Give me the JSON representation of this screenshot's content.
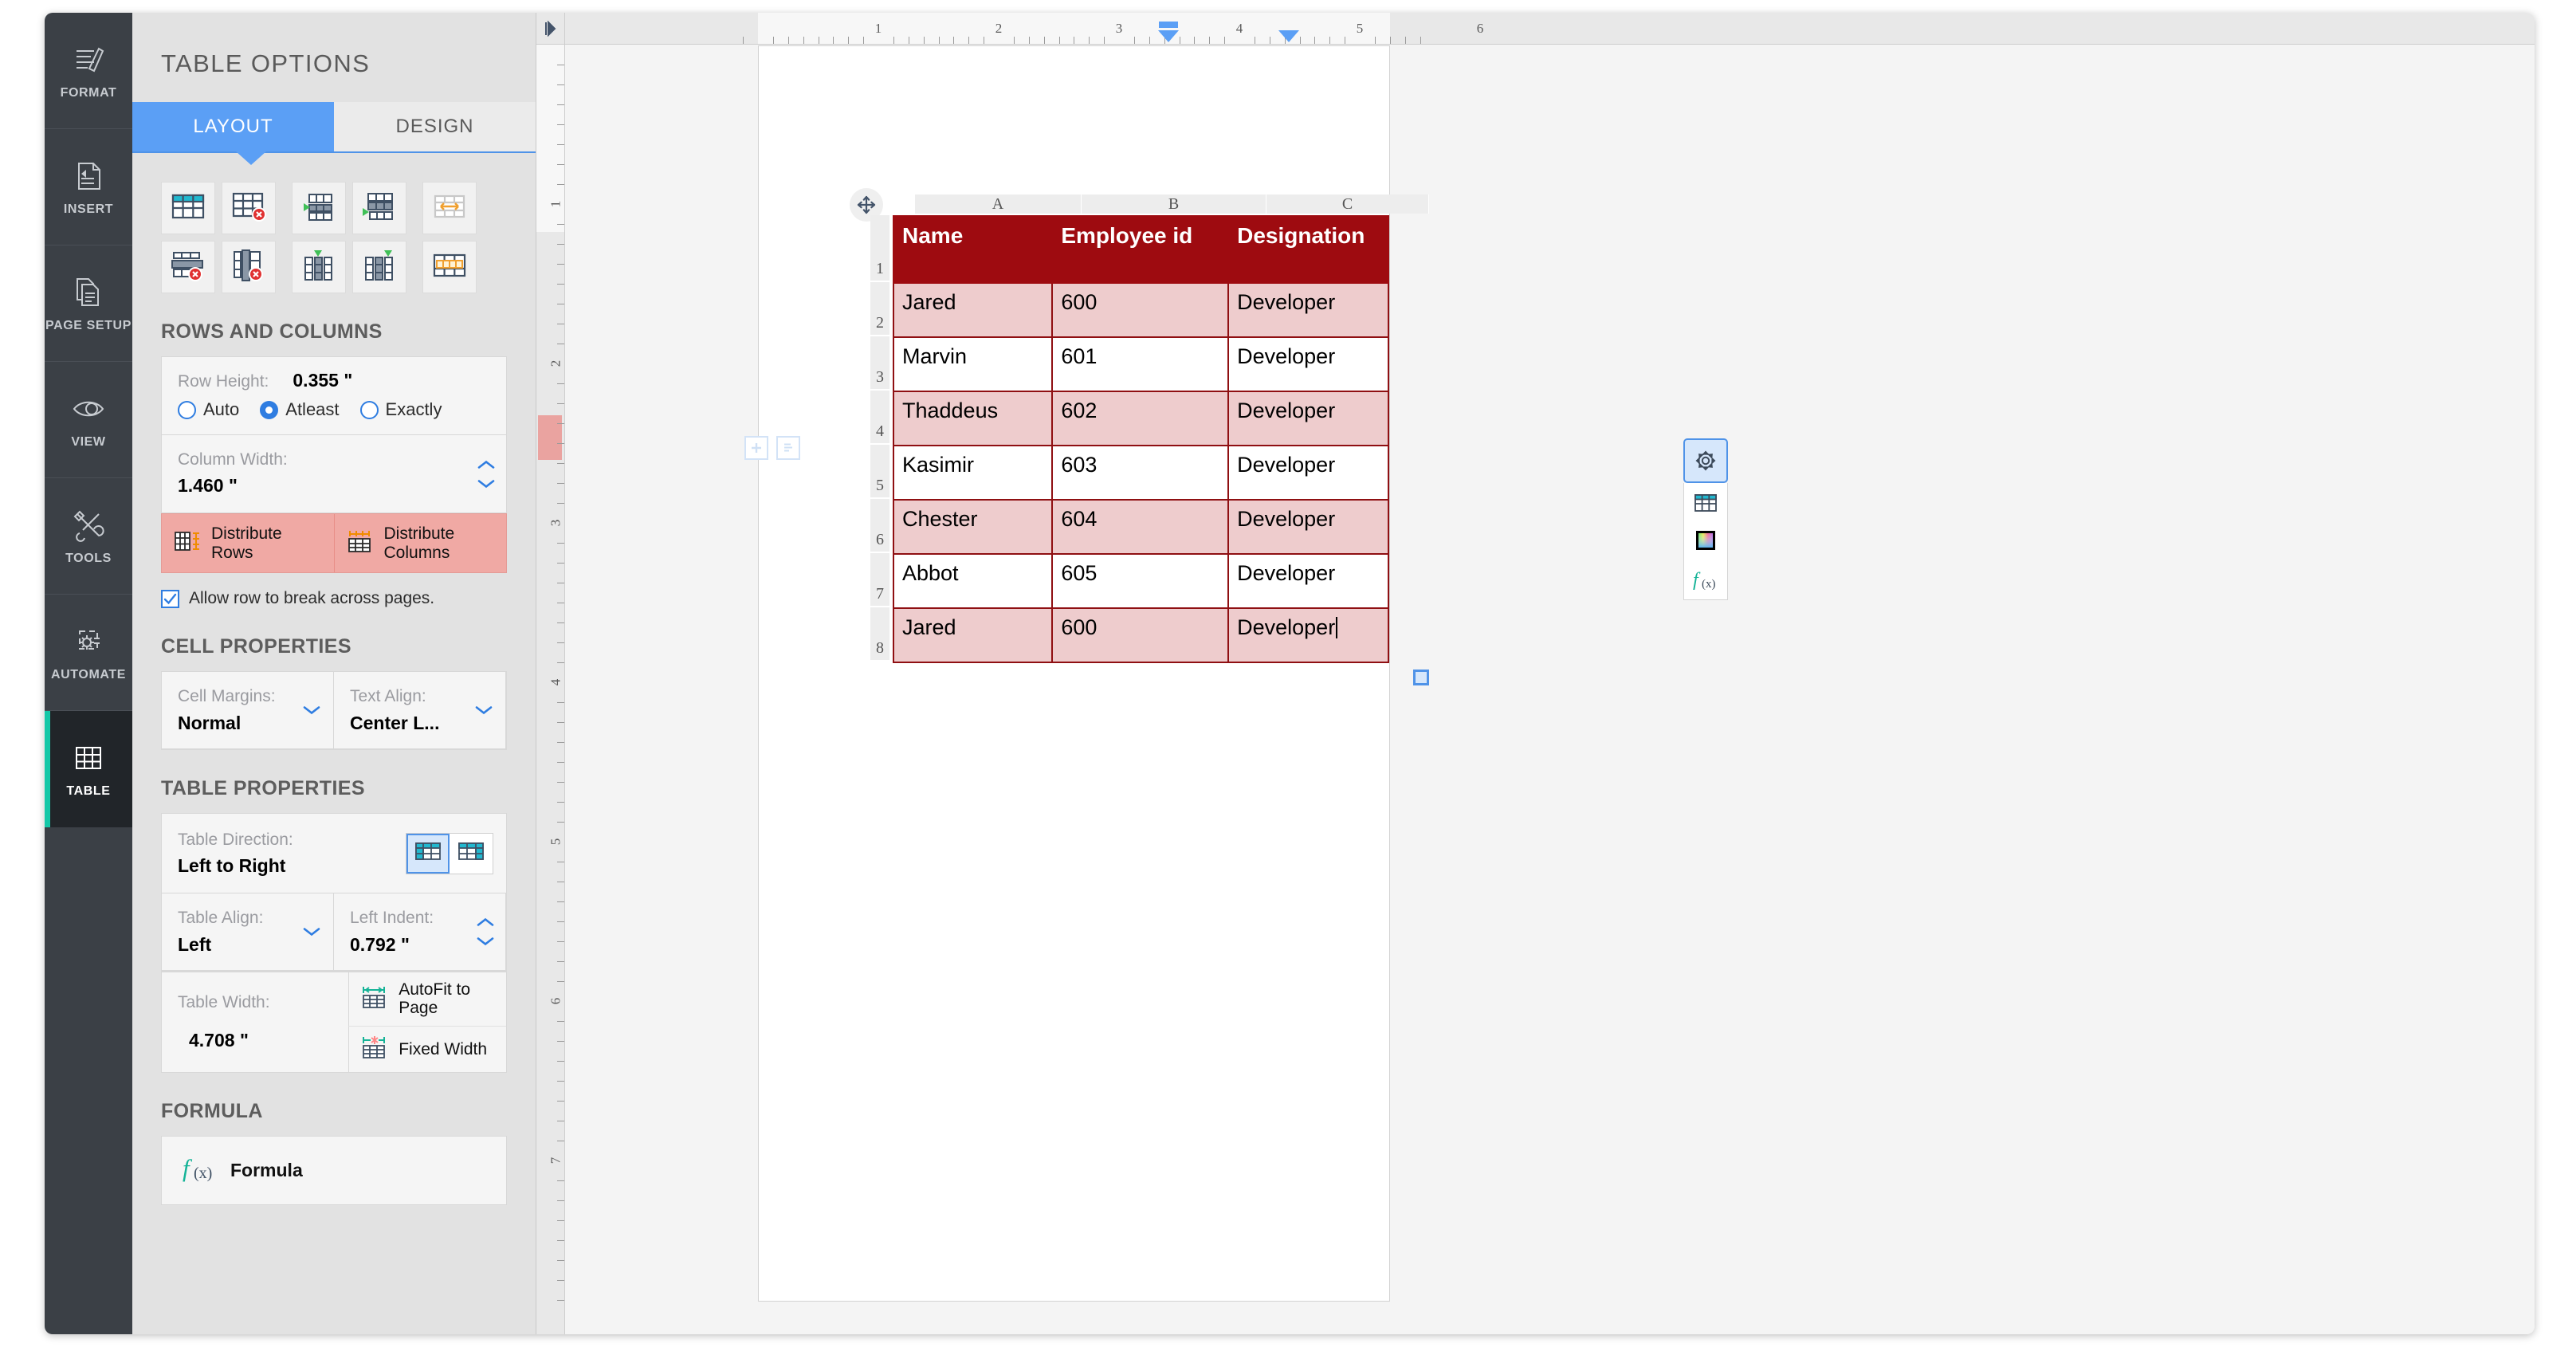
{
  "rail": {
    "items": [
      {
        "label": "FORMAT",
        "icon": "format-brush-icon",
        "active": false
      },
      {
        "label": "INSERT",
        "icon": "insert-document-icon",
        "active": false
      },
      {
        "label": "PAGE SETUP",
        "icon": "page-setup-icon",
        "active": false
      },
      {
        "label": "VIEW",
        "icon": "eye-icon",
        "active": false
      },
      {
        "label": "TOOLS",
        "icon": "tools-icon",
        "active": false
      },
      {
        "label": "AUTOMATE",
        "icon": "automate-gear-icon",
        "active": false
      },
      {
        "label": "TABLE",
        "icon": "table-grid-icon",
        "active": true
      }
    ]
  },
  "panel": {
    "title": "TABLE OPTIONS",
    "tabs": [
      {
        "label": "LAYOUT",
        "active": true
      },
      {
        "label": "DESIGN",
        "active": false
      }
    ],
    "layout_buttons": [
      {
        "name": "insert-table-button",
        "icon": "insert-table-icon"
      },
      {
        "name": "delete-table-button",
        "icon": "delete-table-icon"
      },
      {
        "name": "insert-row-above-button",
        "icon": "insert-row-above-icon"
      },
      {
        "name": "insert-row-below-button",
        "icon": "insert-row-below-icon"
      },
      {
        "name": "merge-cells-button",
        "icon": "merge-cells-icon"
      },
      {
        "name": "delete-row-button",
        "icon": "delete-row-icon"
      },
      {
        "name": "delete-column-button",
        "icon": "delete-column-icon"
      },
      {
        "name": "insert-column-left-button",
        "icon": "insert-column-left-icon"
      },
      {
        "name": "insert-column-right-button",
        "icon": "insert-column-right-icon"
      },
      {
        "name": "split-cells-button",
        "icon": "split-cells-icon"
      }
    ],
    "rows_and_columns": {
      "heading": "ROWS AND COLUMNS",
      "row_height_label": "Row Height:",
      "row_height_value": "0.355 \"",
      "row_height_modes": [
        {
          "label": "Auto",
          "selected": false
        },
        {
          "label": "Atleast",
          "selected": true
        },
        {
          "label": "Exactly",
          "selected": false
        }
      ],
      "column_width_label": "Column Width:",
      "column_width_value": "1.460 \"",
      "distribute_rows_label": "Distribute Rows",
      "distribute_columns_label": "Distribute Columns",
      "allow_break_label": "Allow row to break across pages.",
      "allow_break_checked": true
    },
    "cell_properties": {
      "heading": "CELL PROPERTIES",
      "cell_margins_label": "Cell Margins:",
      "cell_margins_value": "Normal",
      "text_align_label": "Text Align:",
      "text_align_value": "Center L..."
    },
    "table_properties": {
      "heading": "TABLE PROPERTIES",
      "table_direction_label": "Table Direction:",
      "table_direction_value": "Left to Right",
      "direction_ltr_selected": true,
      "table_align_label": "Table Align:",
      "table_align_value": "Left",
      "left_indent_label": "Left Indent:",
      "left_indent_value": "0.792 \"",
      "table_width_label": "Table Width:",
      "table_width_value": "4.708 \"",
      "autofit_label": "AutoFit to Page",
      "fixed_width_label": "Fixed Width"
    },
    "formula": {
      "heading": "FORMULA",
      "button_label": "Formula"
    }
  },
  "document": {
    "h_ruler_numbers": [
      "1",
      "2",
      "3",
      "4",
      "5",
      "6"
    ],
    "v_ruler_numbers": [
      "1",
      "2",
      "3",
      "4",
      "5",
      "6",
      "7"
    ],
    "indent_markers": {
      "first_line": "3.1",
      "right": "4.7"
    },
    "table": {
      "column_headers": [
        "A",
        "B",
        "C"
      ],
      "row_numbers": [
        "1",
        "2",
        "3",
        "4",
        "5",
        "6",
        "7",
        "8"
      ],
      "header_row": [
        "Name",
        "Employee id",
        "Designation"
      ],
      "rows": [
        {
          "cells": [
            "Jared",
            "600",
            "Developer"
          ],
          "shaded": true
        },
        {
          "cells": [
            "Marvin",
            "601",
            "Developer"
          ],
          "shaded": false
        },
        {
          "cells": [
            "Thaddeus",
            "602",
            "Developer"
          ],
          "shaded": true
        },
        {
          "cells": [
            "Kasimir",
            "603",
            "Developer"
          ],
          "shaded": false
        },
        {
          "cells": [
            "Chester",
            "604",
            "Developer"
          ],
          "shaded": true
        },
        {
          "cells": [
            "Abbot",
            "605",
            "Developer"
          ],
          "shaded": false
        },
        {
          "cells": [
            "Jared",
            "600",
            "Developer"
          ],
          "shaded": true,
          "caret_in_last_cell": true
        }
      ]
    },
    "float_toolbar": [
      {
        "name": "table-settings-button",
        "icon": "gear-icon",
        "active": true
      },
      {
        "name": "table-style-button",
        "icon": "table-grid-icon",
        "active": false
      },
      {
        "name": "table-color-button",
        "icon": "color-picker-icon",
        "active": false
      },
      {
        "name": "table-formula-button",
        "icon": "formula-fx-icon",
        "active": false
      }
    ],
    "side_mini_buttons": [
      {
        "name": "add-block-button",
        "icon": "plus-icon"
      },
      {
        "name": "paragraph-marks-button",
        "icon": "paragraph-lines-icon"
      }
    ]
  },
  "colors": {
    "accent_blue": "#5b9ff5",
    "active_teal": "#15c8a8",
    "table_header_red": "#9e0b10",
    "table_shade_pink": "#eecccd",
    "distribute_pink": "#f0a9a4"
  }
}
